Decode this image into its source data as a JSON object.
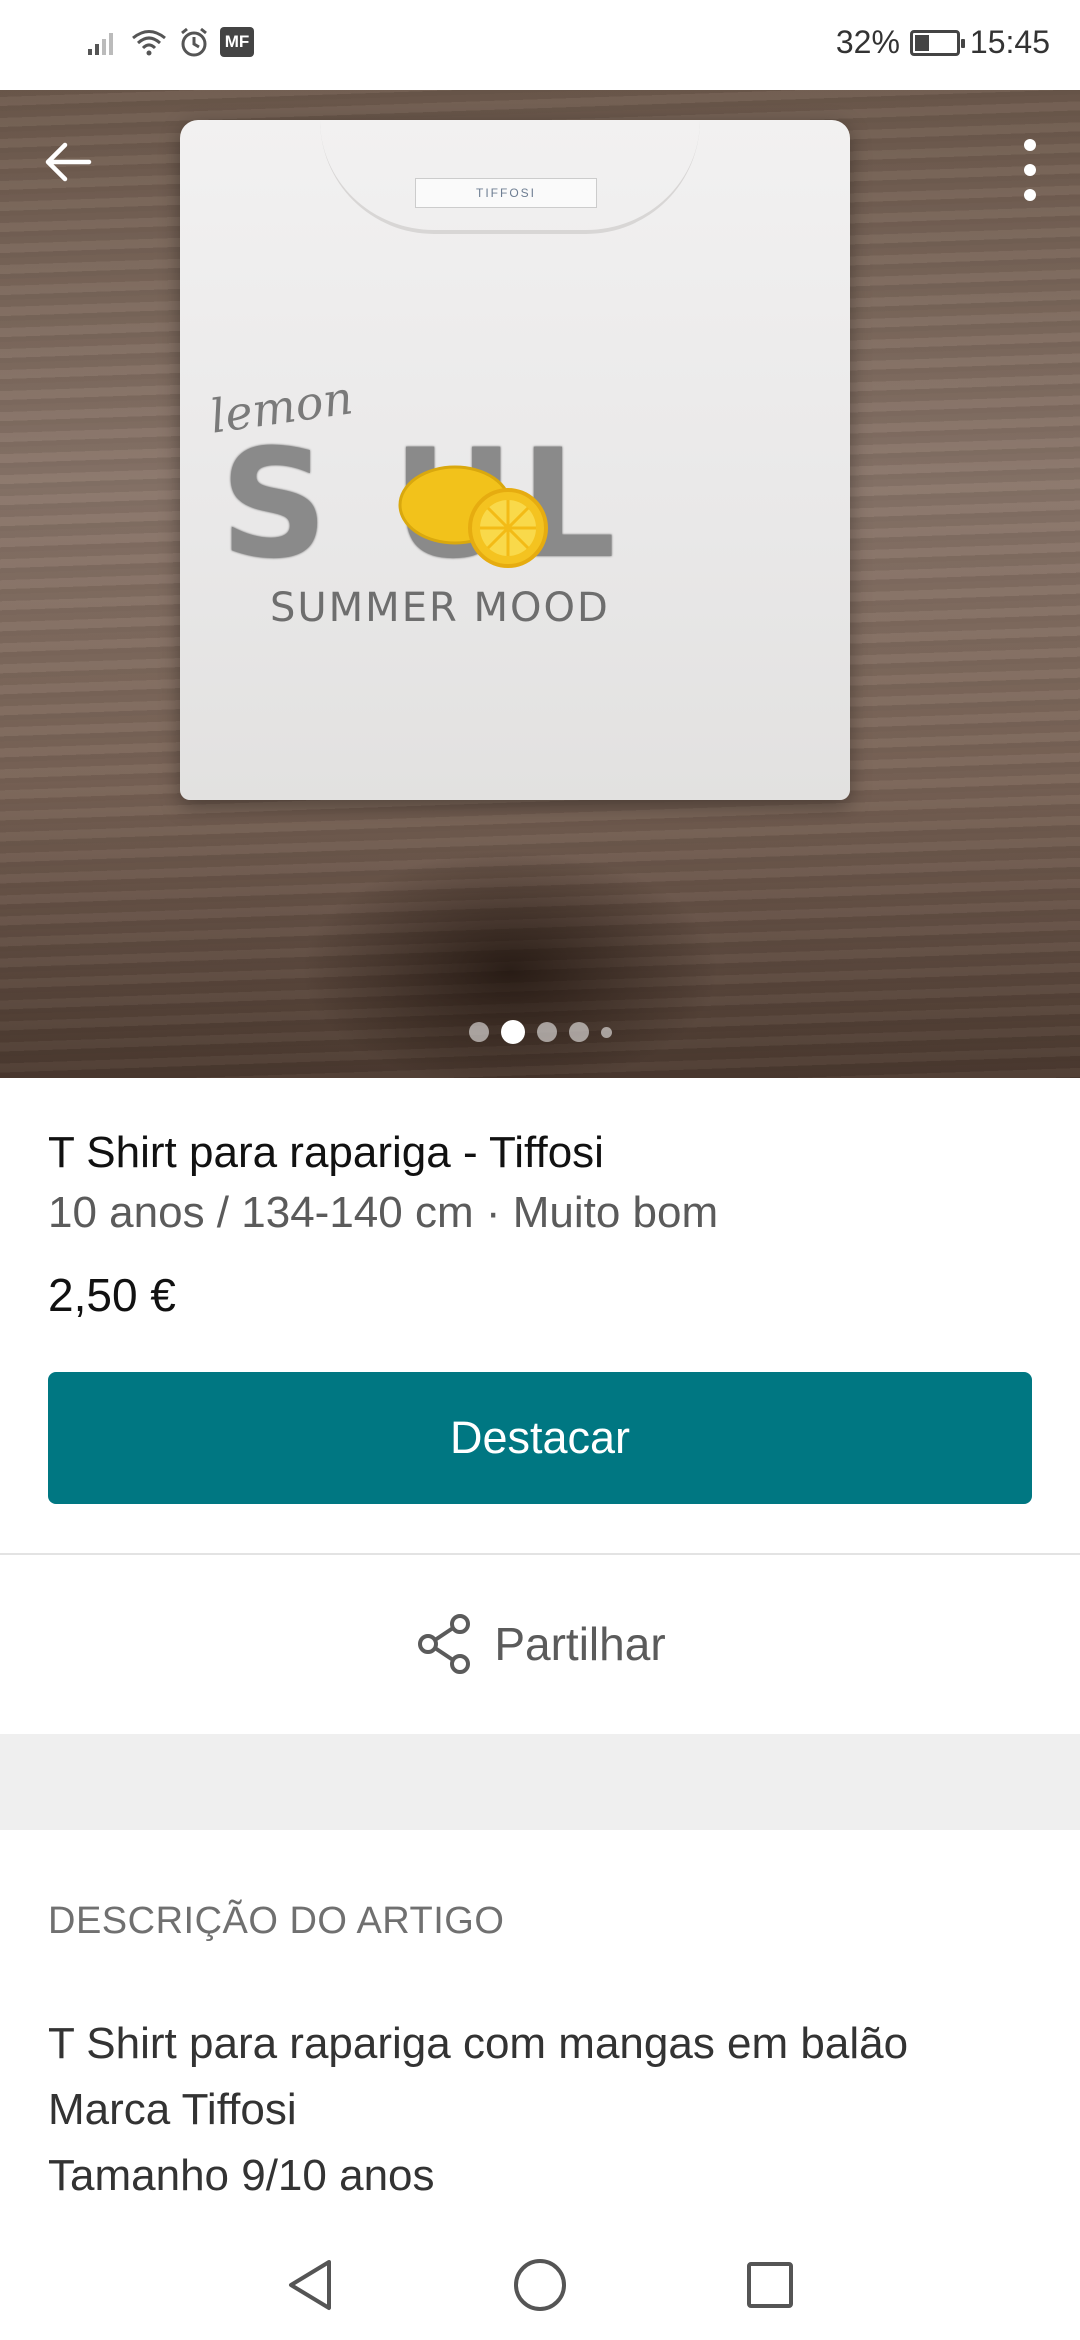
{
  "status_bar": {
    "carrier_badge": "MF",
    "battery": "32%",
    "time": "15:45",
    "icons": [
      "signal-icon",
      "wifi-icon",
      "alarm-icon",
      "battery-icon"
    ]
  },
  "hero": {
    "image_text": {
      "tag": "TIFFOSI",
      "script_word": "lemon",
      "big_word": "S UL",
      "tagline": "SUMMER MOOD"
    },
    "carousel": {
      "total": 5,
      "active_index": 1
    },
    "back_icon": "arrow-left-icon",
    "more_icon": "more-vert-icon"
  },
  "item": {
    "title": "T Shirt para rapariga - Tiffosi",
    "subtitle": "10 anos / 134-140 cm · Muito bom",
    "price": "2,50 €"
  },
  "actions": {
    "primary_label": "Destacar",
    "share_label": "Partilhar"
  },
  "description": {
    "header": "DESCRIÇÃO DO ARTIGO",
    "lines": [
      "T Shirt para rapariga com mangas em balão",
      "Marca Tiffosi",
      "Tamanho 9/10 anos"
    ]
  },
  "colors": {
    "primary": "#007782",
    "background": "#ffffff",
    "band": "#efefef"
  }
}
